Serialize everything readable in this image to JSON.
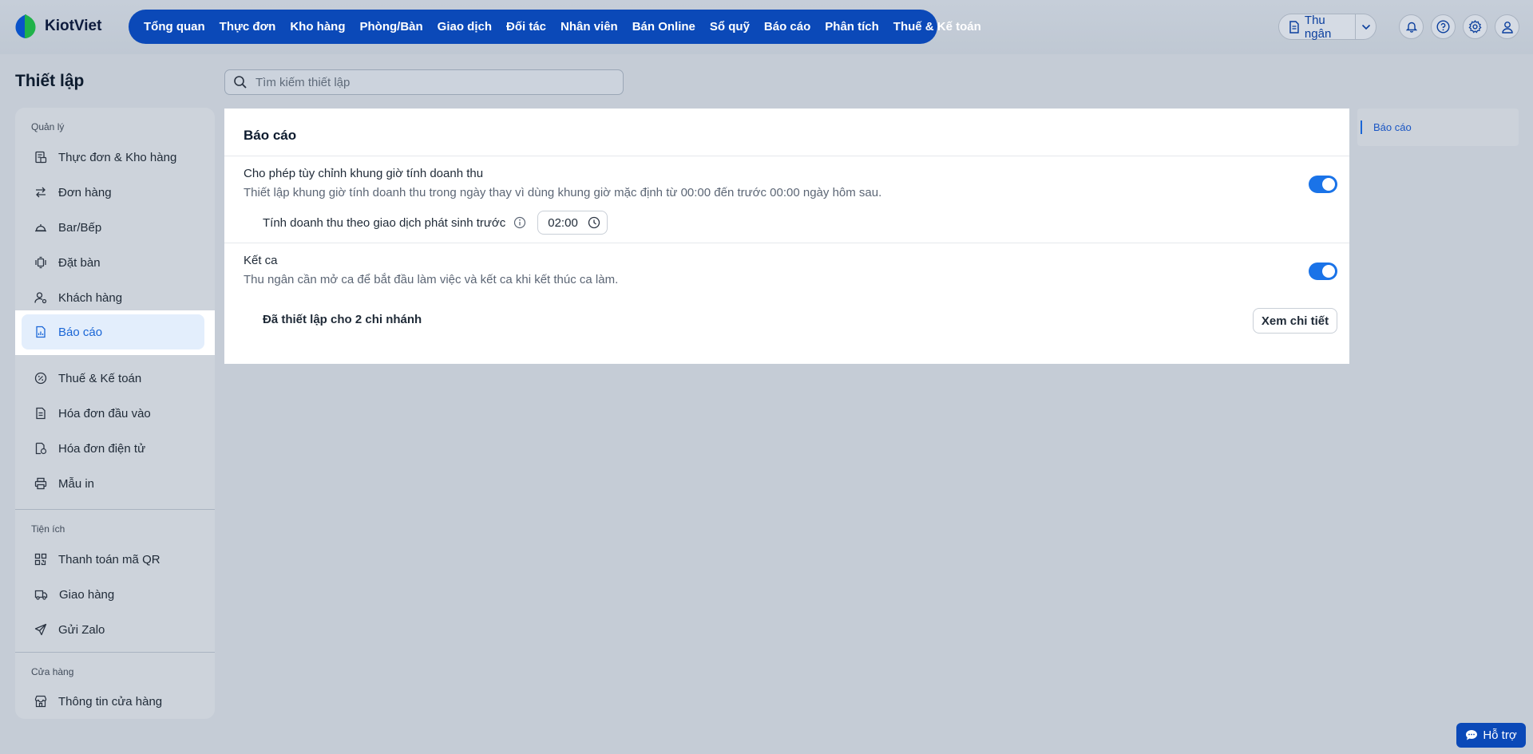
{
  "app": {
    "brand": "KiotViet"
  },
  "nav": {
    "items": [
      "Tổng quan",
      "Thực đơn",
      "Kho hàng",
      "Phòng/Bàn",
      "Giao dịch",
      "Đối tác",
      "Nhân viên",
      "Bán Online",
      "Sổ quỹ",
      "Báo cáo",
      "Phân tích",
      "Thuế & Kế toán"
    ]
  },
  "header": {
    "cashier_label": "Thu ngân"
  },
  "page": {
    "title": "Thiết lập",
    "search_placeholder": "Tìm kiếm thiết lập"
  },
  "sidebar": {
    "section_manage": "Quản lý",
    "section_utilities": "Tiện ích",
    "section_store": "Cửa hàng",
    "items": [
      "Thực đơn & Kho hàng",
      "Đơn hàng",
      "Bar/Bếp",
      "Đặt bàn",
      "Khách hàng",
      "Báo cáo",
      "Thuế & Kế toán",
      "Hóa đơn đầu vào",
      "Hóa đơn điện tử",
      "Mẫu in",
      "Thanh toán mã QR",
      "Giao hàng",
      "Gửi Zalo",
      "Thông tin cửa hàng"
    ]
  },
  "card": {
    "title": "Báo cáo",
    "setting1": {
      "title": "Cho phép tùy chỉnh khung giờ tính doanh thu",
      "desc": "Thiết lập khung giờ tính doanh thu trong ngày thay vì dùng khung giờ mặc định từ 00:00 đến trước 00:00 ngày hôm sau.",
      "sub_label": "Tính doanh thu theo giao dịch phát sinh trước",
      "time_value": "02:00",
      "enabled": true
    },
    "setting2": {
      "title": "Kết ca",
      "desc": "Thu ngân cần mở ca để bắt đầu làm việc và kết ca khi kết thúc ca làm.",
      "branch_text": "Đã thiết lập cho 2 chi nhánh",
      "detail_button": "Xem chi tiết",
      "enabled": true
    }
  },
  "toc": {
    "item": "Báo cáo"
  },
  "support": {
    "label": "Hỗ trợ"
  },
  "colors": {
    "primary": "#0b49b8",
    "accent": "#1a73e8",
    "active_bg": "#e3eefc"
  }
}
